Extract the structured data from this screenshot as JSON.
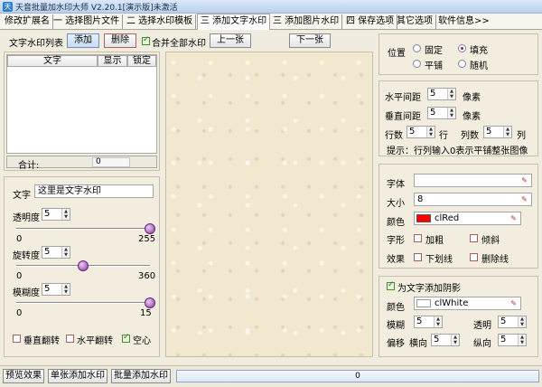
{
  "window": {
    "title": "天音批量加水印大师 V2.20.1[演示版]未激活"
  },
  "tabs": [
    "修改扩展名",
    "一 选择图片文件",
    "二 选择水印模板",
    "三 添加文字水印",
    "三 添加图片水印",
    "四 保存选项",
    "其它选项",
    "软件信息>>"
  ],
  "list_toolbar": {
    "label": "文字水印列表",
    "add": "添加",
    "delete": "删除",
    "merge": "合并全部水印",
    "prev": "上一张",
    "next": "下一张"
  },
  "list": {
    "headers": [
      "文字",
      "显示",
      "锁定"
    ],
    "total_label": "合计:",
    "total_value": "0"
  },
  "text_panel": {
    "text_label": "文字",
    "text_value": "这里是文字水印",
    "opacity_label": "透明度",
    "opacity_value": "5",
    "opacity_min": "0",
    "opacity_max": "255",
    "opacity_level": 255,
    "rotate_label": "旋转度",
    "rotate_value": "5",
    "rotate_min": "0",
    "rotate_max": "360",
    "rotate_level": 180,
    "blur_label": "模糊度",
    "blur_value": "5",
    "blur_min": "0",
    "blur_max": "15",
    "blur_level": 15,
    "flip_v": "垂直翻转",
    "flip_h": "水平翻转",
    "hollow": "空心"
  },
  "position": {
    "label": "位置",
    "fixed": "固定",
    "fill": "填充",
    "tile": "平铺",
    "random": "随机"
  },
  "spacing": {
    "h_label": "水平间距",
    "h_value": "5",
    "h_unit": "像素",
    "v_label": "垂直间距",
    "v_value": "5",
    "v_unit": "像素",
    "rows_label": "行数",
    "rows_value": "5",
    "rows_unit": "行",
    "cols_label": "列数",
    "cols_value": "5",
    "cols_unit": "列",
    "hint": "提示：行列输入0表示平铺整张图像"
  },
  "font": {
    "font_label": "字体",
    "font_value": "",
    "size_label": "大小",
    "size_value": "8",
    "color_label": "颜色",
    "color_value": "clRed",
    "color_hex": "#ff0000",
    "style_label": "字形",
    "bold": "加粗",
    "italic": "倾斜",
    "effect_label": "效果",
    "underline": "下划线",
    "strike": "删除线"
  },
  "shadow": {
    "enable": "为文字添加阴影",
    "color_label": "颜色",
    "color_value": "clWhite",
    "color_hex": "#ffffff",
    "blur_label": "模糊",
    "blur_value": "5",
    "opacity_label": "透明",
    "opacity_value": "5",
    "offset_label": "偏移",
    "x_label": "横向",
    "x_value": "5",
    "y_label": "纵向",
    "y_value": "5"
  },
  "bottom": {
    "preview": "预览效果",
    "single": "单张添加水印",
    "batch": "批量添加水印",
    "progress_text": "0",
    "progress_value": 0
  }
}
